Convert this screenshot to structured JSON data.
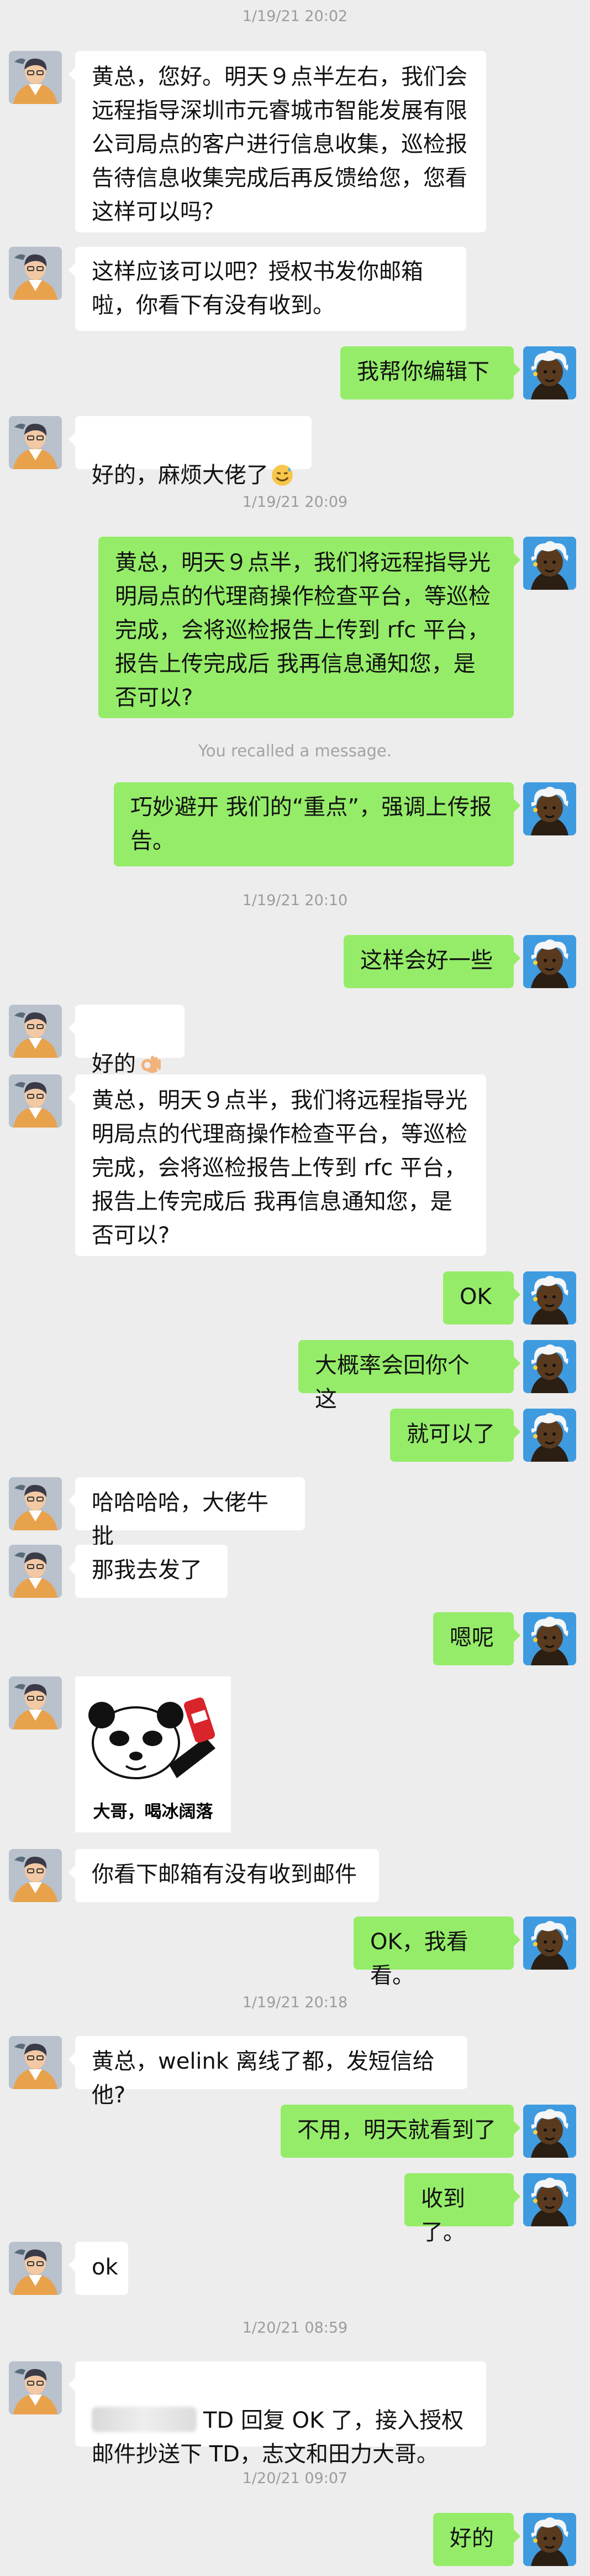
{
  "timestamps": [
    "1/19/21 20:02",
    "1/19/21 20:09",
    "1/19/21 20:10",
    "1/19/21 20:18",
    "1/20/21 08:59",
    "1/20/21 09:07"
  ],
  "recalled_notice": "You recalled a message.",
  "messages": [
    {
      "side": "left",
      "text": "黄总，您好。明天９点半左右，我们会远程指导深圳市元睿城市智能发展有限公司局点的客户进行信息收集，巡检报告待信息收集完成后再反馈给您，您看这样可以吗？"
    },
    {
      "side": "left",
      "text": "这样应该可以吧？授权书发你邮箱啦，你看下有没有收到。"
    },
    {
      "side": "right",
      "text": "我帮你编辑下"
    },
    {
      "side": "left",
      "text": "好的，麻烦大佬了",
      "emoji": "sweat-smile-emoji"
    },
    {
      "side": "right",
      "text": "黄总，明天９点半，我们将远程指导光明局点的代理商操作检查平台，等巡检完成，会将巡检报告上传到 rfc 平台，报告上传完成后 我再信息通知您，是否可以?"
    },
    {
      "side": "right",
      "text": "巧妙避开 我们的“重点”，强调上传报告。"
    },
    {
      "side": "right",
      "text": "这样会好一些"
    },
    {
      "side": "left",
      "text": "好的",
      "emoji": "ok-hand-emoji"
    },
    {
      "side": "left",
      "text": "黄总，明天９点半，我们将远程指导光明局点的代理商操作检查平台，等巡检完成，会将巡检报告上传到 rfc 平台，报告上传完成后 我再信息通知您，是否可以?"
    },
    {
      "side": "right",
      "text": "OK"
    },
    {
      "side": "right",
      "text": "大概率会回你个 这"
    },
    {
      "side": "right",
      "text": "就可以了"
    },
    {
      "side": "left",
      "text": "哈哈哈哈，大佬牛批"
    },
    {
      "side": "left",
      "text": "那我去发了"
    },
    {
      "side": "right",
      "text": "嗯呢"
    },
    {
      "side": "left",
      "sticker_caption": "大哥，喝冰阔落"
    },
    {
      "side": "left",
      "text": "你看下邮箱有没有收到邮件"
    },
    {
      "side": "right",
      "text": "OK，我看看。"
    },
    {
      "side": "left",
      "text": "黄总，welink 离线了都，发短信给他?"
    },
    {
      "side": "right",
      "text": "不用，明天就看到了"
    },
    {
      "side": "right",
      "text": "收到了。"
    },
    {
      "side": "left",
      "text": "ok"
    },
    {
      "side": "left",
      "text": "TD 回复 OK 了，接入授权邮件抄送下 TD，志文和田力大哥。"
    },
    {
      "side": "right",
      "text": "好的"
    }
  ]
}
